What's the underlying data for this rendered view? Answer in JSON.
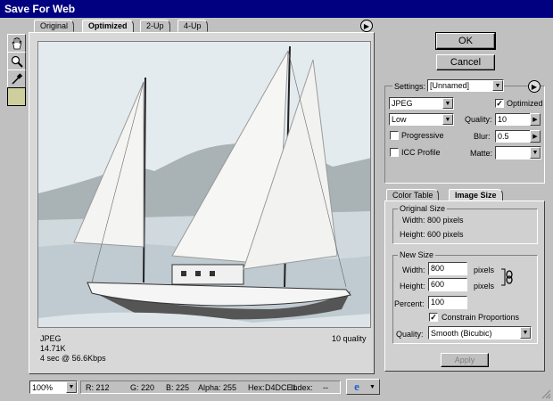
{
  "window": {
    "title": "Save For Web"
  },
  "tabs": [
    {
      "label": "Original"
    },
    {
      "label": "Optimized"
    },
    {
      "label": "2-Up"
    },
    {
      "label": "4-Up"
    }
  ],
  "tools": [
    {
      "name": "hand-tool"
    },
    {
      "name": "zoom-tool"
    },
    {
      "name": "eyedropper-tool"
    }
  ],
  "eyedropper_color": "#D4DCE1",
  "image_info": {
    "format": "JPEG",
    "size": "14.71K",
    "time": "4 sec @ 56.6Kbps",
    "quality": "10 quality"
  },
  "buttons": {
    "ok": "OK",
    "cancel": "Cancel",
    "apply": "Apply"
  },
  "settings": {
    "label": "Settings:",
    "preset": "[Unnamed]",
    "format": "JPEG",
    "optimized_label": "Optimized",
    "optimized_checked": true,
    "quality_preset": "Low",
    "quality_label": "Quality:",
    "quality_value": "10",
    "progressive_label": "Progressive",
    "blur_label": "Blur:",
    "blur_value": "0.5",
    "icc_label": "ICC Profile",
    "matte_label": "Matte:"
  },
  "panel_tabs": [
    {
      "label": "Color Table"
    },
    {
      "label": "Image Size"
    }
  ],
  "original_size": {
    "heading": "Original Size",
    "width": "Width: 800 pixels",
    "height": "Height: 600 pixels"
  },
  "new_size": {
    "heading": "New Size",
    "width_label": "Width:",
    "width_value": "800",
    "height_label": "Height:",
    "height_value": "600",
    "unit": "pixels",
    "percent_label": "Percent:",
    "percent_value": "100",
    "constrain_label": "Constrain Proportions",
    "constrain_checked": true,
    "quality_label": "Quality:",
    "quality_value": "Smooth (Bicubic)"
  },
  "statusbar": {
    "zoom": "100%",
    "r": "R: 212",
    "g": "G: 220",
    "b": "B: 225",
    "alpha": "Alpha: 255",
    "hex": "Hex:",
    "hex_value": "D4DCE1",
    "index": "Index:",
    "index_value": "--"
  }
}
